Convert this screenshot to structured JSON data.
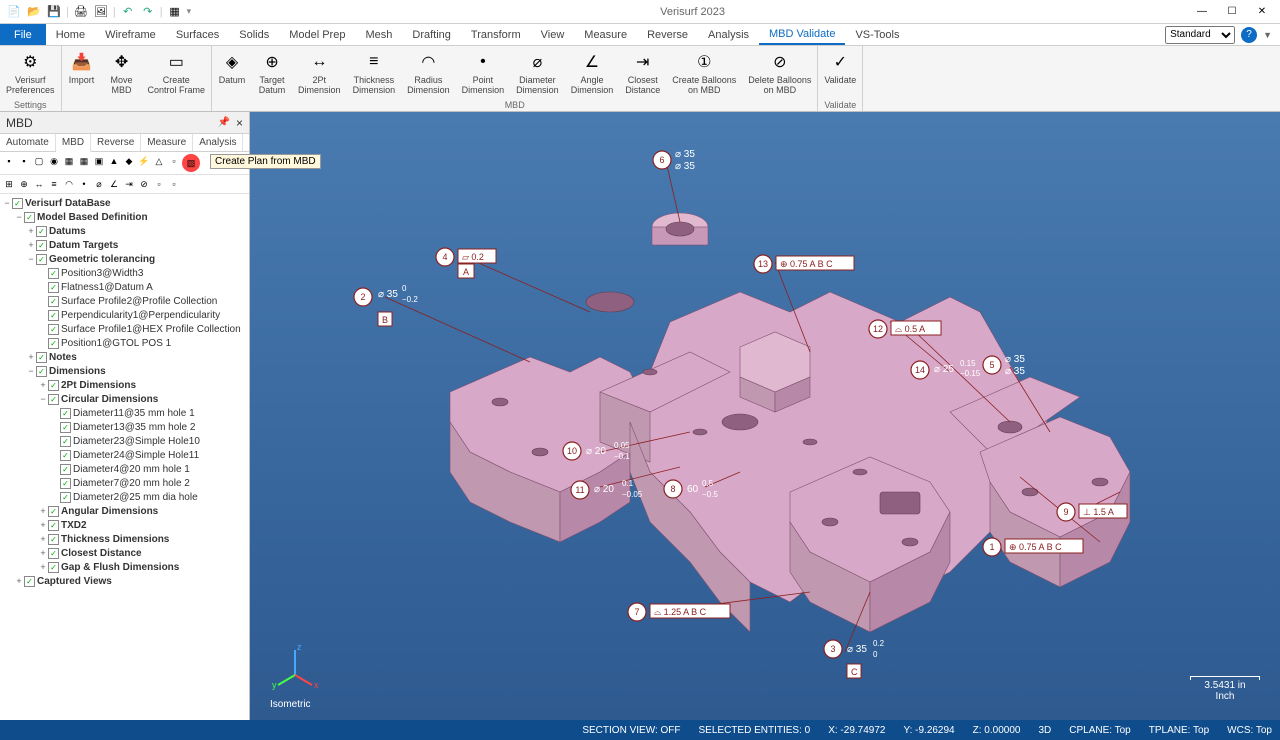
{
  "app_title": "Verisurf 2023",
  "qat_icons": [
    "new",
    "open",
    "save",
    "print",
    "print-area",
    "undo",
    "redo",
    "refresh"
  ],
  "ribbon": {
    "file": "File",
    "tabs": [
      "Home",
      "Wireframe",
      "Surfaces",
      "Solids",
      "Model Prep",
      "Mesh",
      "Drafting",
      "Transform",
      "View",
      "Measure",
      "Reverse",
      "Analysis",
      "MBD Validate",
      "VS-Tools"
    ],
    "active_tab": "MBD Validate",
    "standard_dropdown": "Standard",
    "groups": [
      {
        "label": "Settings",
        "buttons": [
          {
            "label": "Verisurf\nPreferences",
            "icon": "⚙"
          }
        ]
      },
      {
        "label": "",
        "buttons": [
          {
            "label": "Import",
            "icon": "📥"
          },
          {
            "label": "Move\nMBD",
            "icon": "✥"
          },
          {
            "label": "Create\nControl Frame",
            "icon": "▭"
          }
        ]
      },
      {
        "label": "MBD",
        "buttons": [
          {
            "label": "Datum",
            "icon": "◈"
          },
          {
            "label": "Target\nDatum",
            "icon": "⊕"
          },
          {
            "label": "2Pt\nDimension",
            "icon": "↔"
          },
          {
            "label": "Thickness\nDimension",
            "icon": "≡"
          },
          {
            "label": "Radius\nDimension",
            "icon": "◠"
          },
          {
            "label": "Point\nDimension",
            "icon": "•"
          },
          {
            "label": "Diameter\nDimension",
            "icon": "⌀"
          },
          {
            "label": "Angle\nDimension",
            "icon": "∠"
          },
          {
            "label": "Closest\nDistance",
            "icon": "⇥"
          },
          {
            "label": "Create Balloons\non MBD",
            "icon": "①"
          },
          {
            "label": "Delete Balloons\non MBD",
            "icon": "⊘"
          }
        ]
      },
      {
        "label": "Validate",
        "buttons": [
          {
            "label": "Validate",
            "icon": "✓"
          }
        ]
      }
    ]
  },
  "left_panel": {
    "title": "MBD",
    "tabs": [
      "Automate",
      "MBD",
      "Reverse",
      "Measure",
      "Analysis"
    ],
    "active_tab": "MBD",
    "tooltip": "Create Plan from MBD",
    "tree": [
      {
        "indent": 0,
        "toggle": "−",
        "check": true,
        "label": "Verisurf DataBase",
        "bold": true
      },
      {
        "indent": 1,
        "toggle": "−",
        "check": true,
        "label": "Model Based Definition",
        "bold": true
      },
      {
        "indent": 2,
        "toggle": "+",
        "check": true,
        "label": "Datums",
        "bold": true
      },
      {
        "indent": 2,
        "toggle": "+",
        "check": true,
        "label": "Datum Targets",
        "bold": true
      },
      {
        "indent": 2,
        "toggle": "−",
        "check": true,
        "label": "Geometric tolerancing",
        "bold": true
      },
      {
        "indent": 3,
        "toggle": "",
        "check": true,
        "label": "Position3@Width3"
      },
      {
        "indent": 3,
        "toggle": "",
        "check": true,
        "label": "Flatness1@Datum A"
      },
      {
        "indent": 3,
        "toggle": "",
        "check": true,
        "label": "Surface Profile2@Profile Collection"
      },
      {
        "indent": 3,
        "toggle": "",
        "check": true,
        "label": "Perpendicularity1@Perpendicularity"
      },
      {
        "indent": 3,
        "toggle": "",
        "check": true,
        "label": "Surface Profile1@HEX Profile Collection"
      },
      {
        "indent": 3,
        "toggle": "",
        "check": true,
        "label": "Position1@GTOL POS 1"
      },
      {
        "indent": 2,
        "toggle": "+",
        "check": true,
        "label": "Notes",
        "bold": true
      },
      {
        "indent": 2,
        "toggle": "−",
        "check": true,
        "label": "Dimensions",
        "bold": true
      },
      {
        "indent": 3,
        "toggle": "+",
        "check": true,
        "label": "2Pt Dimensions",
        "bold": true
      },
      {
        "indent": 3,
        "toggle": "−",
        "check": true,
        "label": "Circular Dimensions",
        "bold": true
      },
      {
        "indent": 4,
        "toggle": "",
        "check": true,
        "label": "Diameter11@35 mm hole 1"
      },
      {
        "indent": 4,
        "toggle": "",
        "check": true,
        "label": "Diameter13@35 mm hole 2"
      },
      {
        "indent": 4,
        "toggle": "",
        "check": true,
        "label": "Diameter23@Simple Hole10"
      },
      {
        "indent": 4,
        "toggle": "",
        "check": true,
        "label": "Diameter24@Simple Hole11"
      },
      {
        "indent": 4,
        "toggle": "",
        "check": true,
        "label": "Diameter4@20 mm hole 1"
      },
      {
        "indent": 4,
        "toggle": "",
        "check": true,
        "label": "Diameter7@20 mm hole 2"
      },
      {
        "indent": 4,
        "toggle": "",
        "check": true,
        "label": "Diameter2@25 mm dia hole"
      },
      {
        "indent": 3,
        "toggle": "+",
        "check": true,
        "label": "Angular Dimensions",
        "bold": true
      },
      {
        "indent": 3,
        "toggle": "+",
        "check": true,
        "label": "TXD2",
        "bold": true
      },
      {
        "indent": 3,
        "toggle": "+",
        "check": true,
        "label": "Thickness Dimensions",
        "bold": true
      },
      {
        "indent": 3,
        "toggle": "+",
        "check": true,
        "label": "Closest Distance",
        "bold": true
      },
      {
        "indent": 3,
        "toggle": "+",
        "check": true,
        "label": "Gap & Flush Dimensions",
        "bold": true
      },
      {
        "indent": 1,
        "toggle": "+",
        "check": true,
        "label": "Captured Views",
        "bold": true
      }
    ]
  },
  "viewport": {
    "view_name": "Isometric",
    "scale": "3.5431 in",
    "scale_unit": "Inch",
    "annotations": {
      "b1": {
        "n": "1",
        "fcf": "⊕ 0.75 A B C"
      },
      "b2": {
        "n": "2",
        "dim": "⌀ 35",
        "tol_u": "0",
        "tol_l": "−0.2",
        "datum": "B"
      },
      "b3": {
        "n": "3",
        "dim": "⌀ 35",
        "tol_u": "0.2",
        "tol_l": "0",
        "datum": "C"
      },
      "b4": {
        "n": "4",
        "fcf": "▱ 0.2",
        "datum": "A"
      },
      "b5": {
        "n": "5",
        "dim": "⌀ 35",
        "dim2": "⌀ 35"
      },
      "b6": {
        "n": "6",
        "dim": "⌀ 35",
        "dim2": "⌀ 35"
      },
      "b7": {
        "n": "7",
        "fcf": "⌓ 1.25 A B C"
      },
      "b8": {
        "n": "8",
        "dim": "60",
        "tol_u": "0.5",
        "tol_l": "−0.5"
      },
      "b9": {
        "n": "9",
        "fcf": "⊥ 1.5 A"
      },
      "b10": {
        "n": "10",
        "dim": "⌀ 20",
        "tol_u": "0.05",
        "tol_l": "−0.1"
      },
      "b11": {
        "n": "11",
        "dim": "⌀ 20",
        "tol_u": "0.1",
        "tol_l": "−0.05"
      },
      "b12": {
        "n": "12",
        "fcf": "⌓ 0.5 A"
      },
      "b13": {
        "n": "13",
        "fcf": "⊕ 0.75 A B C"
      },
      "b14": {
        "n": "14",
        "dim": "⌀ 25",
        "tol_u": "0.15",
        "tol_l": "−0.15"
      }
    }
  },
  "statusbar": {
    "section_view": "SECTION VIEW: OFF",
    "selected": "SELECTED ENTITIES: 0",
    "x": "X: -29.74972",
    "y": "Y: -9.26294",
    "z": "Z: 0.00000",
    "mode": "3D",
    "cplane": "CPLANE: Top",
    "tplane": "TPLANE: Top",
    "wcs": "WCS: Top"
  }
}
